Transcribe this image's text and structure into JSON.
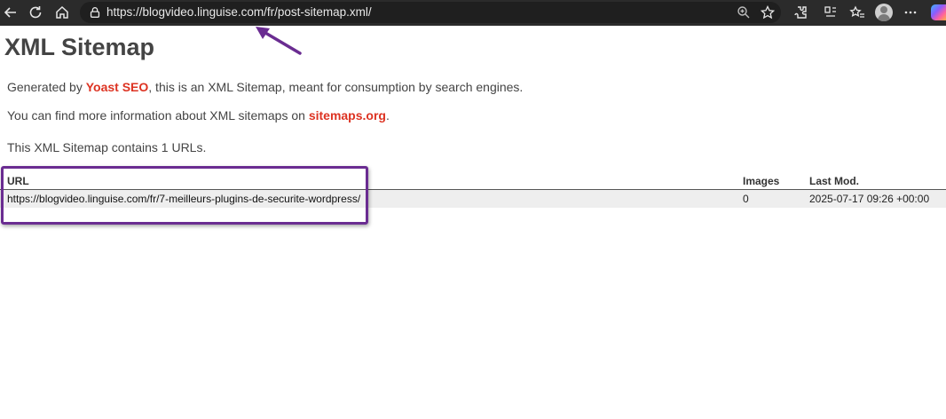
{
  "browser": {
    "url": "https://blogvideo.linguise.com/fr/post-sitemap.xml/",
    "icons": [
      "back-icon",
      "reload-icon",
      "home-icon",
      "lock-icon",
      "zoom-icon",
      "star-icon",
      "extensions-icon",
      "split-screen-icon",
      "favorites-icon",
      "profile-avatar",
      "more-icon",
      "copilot-icon"
    ]
  },
  "page": {
    "title": "XML Sitemap",
    "intro": {
      "prefix": "Generated by ",
      "link": "Yoast SEO",
      "suffix": ", this is an XML Sitemap, meant for consumption by search engines."
    },
    "info": {
      "prefix": "You can find more information about XML sitemaps on ",
      "link": "sitemaps.org",
      "suffix": "."
    },
    "count_text": "This XML Sitemap contains 1 URLs."
  },
  "table": {
    "headers": {
      "url": "URL",
      "images": "Images",
      "lastmod": "Last Mod."
    },
    "rows": [
      {
        "url": "https://blogvideo.linguise.com/fr/7-meilleurs-plugins-de-securite-wordpress/",
        "images": "0",
        "lastmod": "2025-07-17 09:26 +00:00"
      }
    ]
  },
  "colors": {
    "link": "#dd3322",
    "annotation": "#6a2c91",
    "toolbar": "#2b2b2b"
  }
}
